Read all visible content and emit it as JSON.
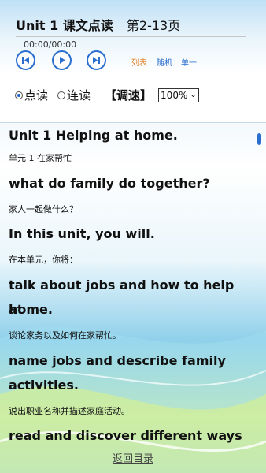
{
  "header": {
    "unit_title": "Unit 1 课文点读",
    "pages": "第2-13页",
    "time": "00:00/00:00"
  },
  "controls": {
    "prev_icon": "skip-previous-icon",
    "play_icon": "play-icon",
    "next_icon": "skip-next-icon",
    "mode_list": "列表",
    "mode_random": "随机",
    "mode_single": "单一",
    "mode_list_color": "#e07b1a",
    "mode_other_color": "#2a6fd0"
  },
  "options": {
    "radio_diandu": "点读",
    "radio_liandu": "连读",
    "speed_label": "【调速】",
    "speed_value": "100%"
  },
  "content": [
    {
      "text": "Unit 1 Helping at home.",
      "lang": "en"
    },
    {
      "text": "单元 1 在家帮忙",
      "lang": "zh"
    },
    {
      "text": "what do family do together?",
      "lang": "en"
    },
    {
      "text": "家人一起做什么？",
      "lang": "zh"
    },
    {
      "text": "In this unit, you will.",
      "lang": "en"
    },
    {
      "text": "在本单元，你将：",
      "lang": "zh"
    },
    {
      "text": "talk about jobs and how to help at",
      "lang": "en"
    },
    {
      "text": "home.",
      "lang": "en"
    },
    {
      "text": "谈论家务以及如何在家帮忙。",
      "lang": "zh"
    },
    {
      "text": "name jobs and describe family",
      "lang": "en"
    },
    {
      "text": "activities.",
      "lang": "en"
    },
    {
      "text": "说出职业名称并描述家庭活动。",
      "lang": "zh"
    },
    {
      "text": "read and discover different ways to",
      "lang": "en"
    }
  ],
  "footer": {
    "back_link": "返回目录"
  }
}
